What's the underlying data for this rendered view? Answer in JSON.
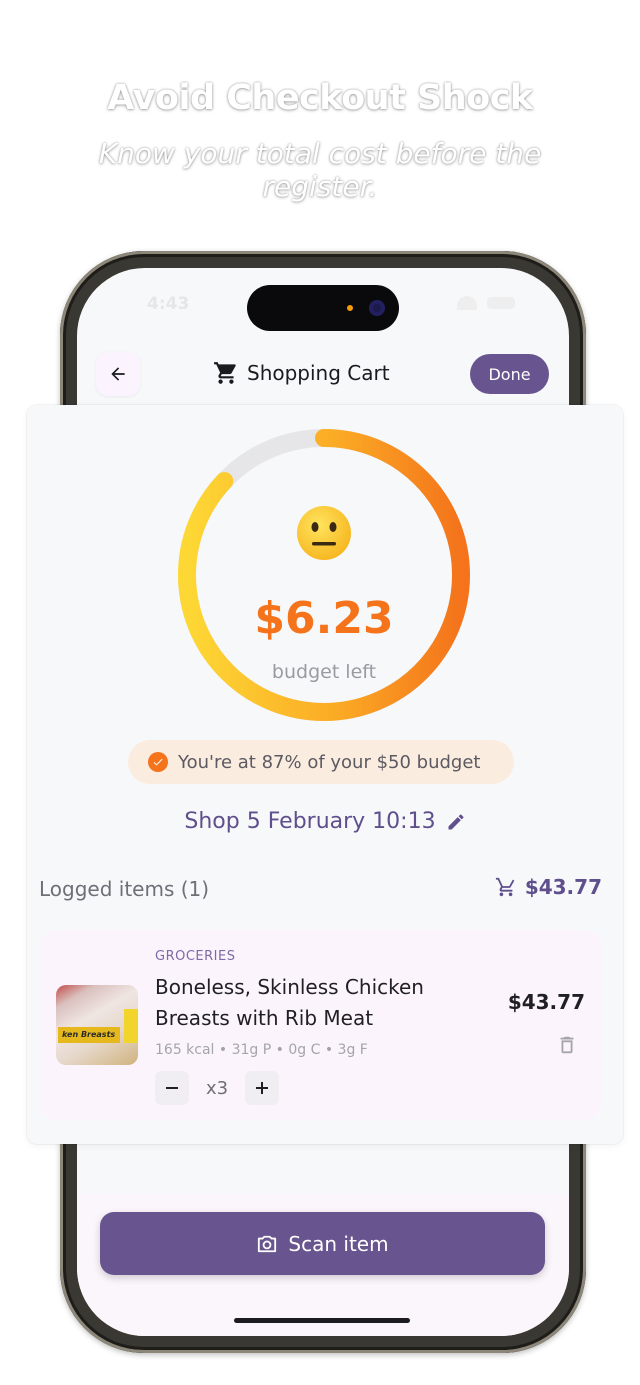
{
  "promo": {
    "headline": "Avoid Checkout Shock",
    "subline": "Know your total cost before the register."
  },
  "status_bar": {
    "time": "4:43"
  },
  "header": {
    "title": "Shopping Cart",
    "done_label": "Done"
  },
  "budget": {
    "remaining": "$6.23",
    "caption": "budget left",
    "emoji": "😐",
    "used_fraction": 0.87,
    "usage_text": "You're at 87% of your $50 budget"
  },
  "shop": {
    "title": "Shop 5 February 10:13"
  },
  "logged": {
    "label": "Logged items (1)",
    "total": "$43.77"
  },
  "items": [
    {
      "category": "GROCERIES",
      "name": "Boneless, Skinless Chicken Breasts with Rib Meat",
      "macros": "165 kcal • 31g P • 0g C • 3g F",
      "price": "$43.77",
      "quantity": "x3",
      "thumb_label": "ken Breasts"
    }
  ],
  "actions": {
    "scan_label": "Scan item"
  },
  "colors": {
    "accent": "#68548e",
    "budget_orange": "#f4731b",
    "gauge_yellow": "#fdd835",
    "background": "#f7f8fa"
  },
  "icons": {
    "back": "arrow-left-icon",
    "cart": "shopping-cart-icon",
    "check": "check-circle-icon",
    "edit": "pencil-icon",
    "trash": "trash-icon",
    "camera": "camera-icon"
  }
}
